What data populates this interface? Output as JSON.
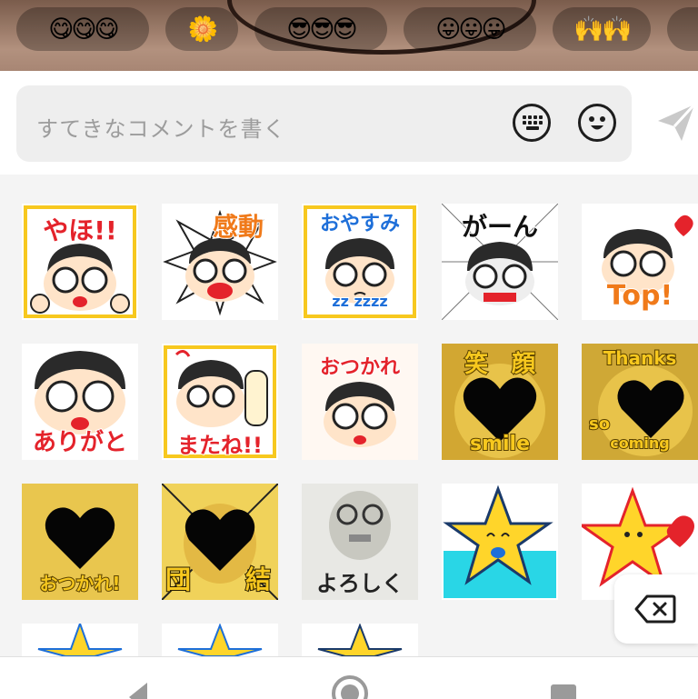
{
  "reactions": [
    {
      "emoji": "😋😋😋",
      "name": "yum-reaction"
    },
    {
      "emoji": "🌼",
      "name": "daisy-reaction"
    },
    {
      "emoji": "😎😎😎",
      "name": "cool-reaction"
    },
    {
      "emoji": "😛😛😛",
      "name": "tongue-reaction"
    },
    {
      "emoji": "🙌🙌",
      "name": "raised-hands-reaction"
    }
  ],
  "comment": {
    "placeholder": "すてきなコメントを書く",
    "keyboard_icon": "keyboard-icon",
    "emoji_icon": "smiley-icon",
    "send_icon": "send-icon"
  },
  "stickers": {
    "row1": {
      "s1": "やほ!!",
      "s2": "感動",
      "s3": "おやすみ",
      "s3_sub": "zz zzzz",
      "s4": "がーん",
      "s5": "Top!"
    },
    "row2": {
      "s1": "ありがと",
      "s2": "またね!!",
      "s3": "おつかれ",
      "s4_top": "笑　顔",
      "s4_bottom": "smile",
      "s5_top": "Thanks",
      "s5_mid": "so",
      "s5_bottom": "coming"
    },
    "row3": {
      "s1": "おつかれ!",
      "s2_left": "団",
      "s2_right": "結",
      "s3": "よろしく"
    }
  },
  "colors": {
    "accent_yellow": "#f7c81e",
    "accent_red": "#e4232b",
    "accent_blue": "#1e6fd9",
    "star_yellow": "#ffd52a",
    "water_cyan": "#29d6e6"
  },
  "icons": {
    "backspace": "backspace-icon",
    "nav_back": "back-triangle-icon",
    "nav_home": "home-circle-icon",
    "nav_recents": "recents-square-icon"
  }
}
